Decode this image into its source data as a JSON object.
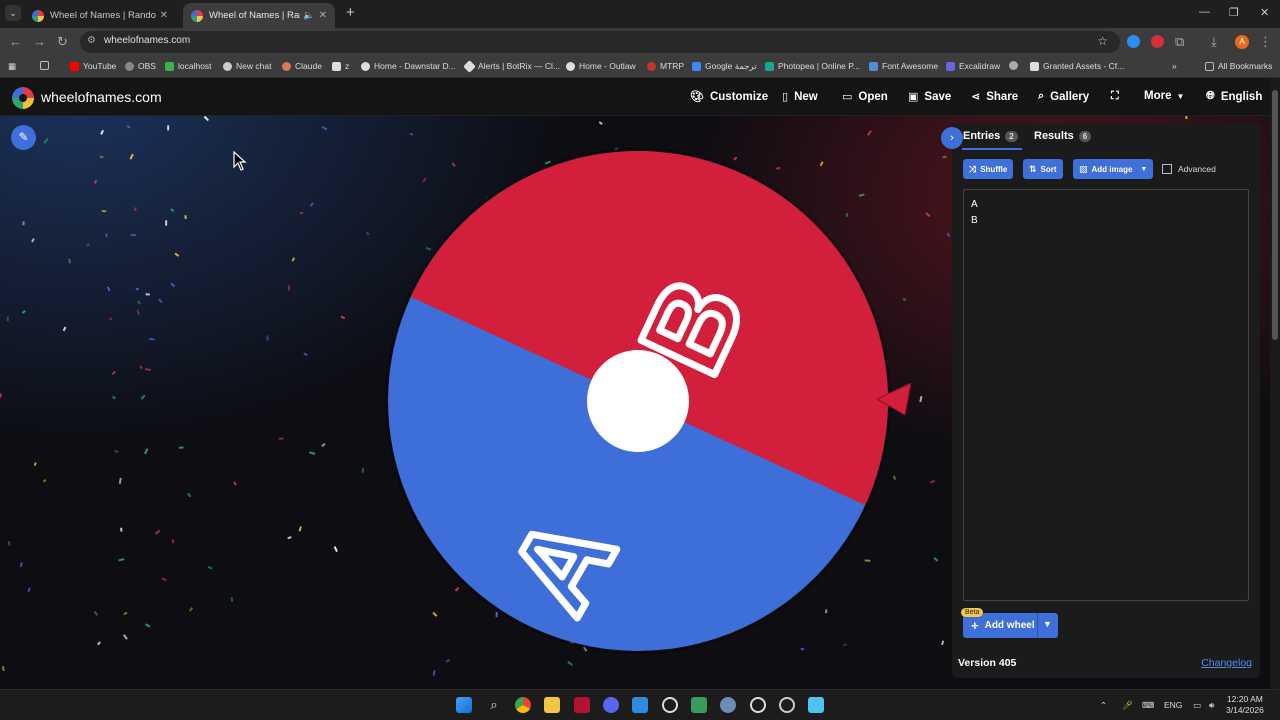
{
  "browser": {
    "tabs": [
      {
        "title": "Wheel of Names | Random nam",
        "active": false
      },
      {
        "title": "Wheel of Names | Random",
        "active": true
      }
    ],
    "url": "wheelofnames.com",
    "profile_initial": "A",
    "bookmarks": [
      {
        "label": "",
        "icon": "folder-icon"
      },
      {
        "label": "YouTube",
        "color": "#ff0000"
      },
      {
        "label": "OBS",
        "color": "#888888"
      },
      {
        "label": "localhost",
        "color": "#3bb34a"
      },
      {
        "label": "New chat",
        "color": "#cccccc"
      },
      {
        "label": "Claude",
        "color": "#d97757"
      },
      {
        "label": "z",
        "color": "#dddddd"
      },
      {
        "label": "Home - Dawnstar D...",
        "color": "#dddddd"
      },
      {
        "label": "Alerts | BotRix — Cl...",
        "color": "#dddddd"
      },
      {
        "label": "Home - Outlaw",
        "color": "#dddddd"
      },
      {
        "label": "MTRP",
        "color": "#c0392b"
      },
      {
        "label": "Google ترجمة",
        "color": "#4285f4"
      },
      {
        "label": "Photopea | Online P...",
        "color": "#18a497"
      },
      {
        "label": "Font Awesome",
        "color": "#538dd7"
      },
      {
        "label": "Excalidraw",
        "color": "#6965db"
      },
      {
        "label": "",
        "color": "#aaaaaa"
      },
      {
        "label": "Granted Assets - Cf...",
        "color": "#dddddd"
      }
    ],
    "all_bookmarks": "All Bookmarks"
  },
  "site": {
    "name": "wheelofnames.com",
    "menu": [
      {
        "label": "Customize",
        "icon": "palette-icon"
      },
      {
        "label": "New",
        "icon": "file-icon"
      },
      {
        "label": "Open",
        "icon": "folder-open-icon"
      },
      {
        "label": "Save",
        "icon": "save-icon"
      },
      {
        "label": "Share",
        "icon": "share-icon"
      },
      {
        "label": "Gallery",
        "icon": "search-icon"
      },
      {
        "label": "",
        "icon": "fullscreen-icon"
      },
      {
        "label": "More",
        "icon": "chevron-down-icon"
      },
      {
        "label": "English",
        "icon": "globe-icon"
      }
    ]
  },
  "wheel": {
    "slices": [
      {
        "label": "B",
        "color": "#d21f3c"
      },
      {
        "label": "A",
        "color": "#3e6fd8"
      }
    ]
  },
  "panel": {
    "tabs": [
      {
        "label": "Entries",
        "count": "2"
      },
      {
        "label": "Results",
        "count": "6"
      }
    ],
    "buttons": {
      "shuffle": "Shuffle",
      "sort": "Sort",
      "add_image": "Add image"
    },
    "advanced_label": "Advanced",
    "entries": [
      "A",
      "B"
    ],
    "beta": "Beta",
    "add_wheel": "Add wheel",
    "version": "Version 405",
    "changelog": "Changelog"
  },
  "taskbar": {
    "lang": "ENG",
    "time": "12:20 AM",
    "date": "3/14/2026"
  },
  "colors": {
    "accent": "#3f6fd9",
    "wheel_red": "#d21f3c",
    "wheel_blue": "#3e6fd8"
  }
}
